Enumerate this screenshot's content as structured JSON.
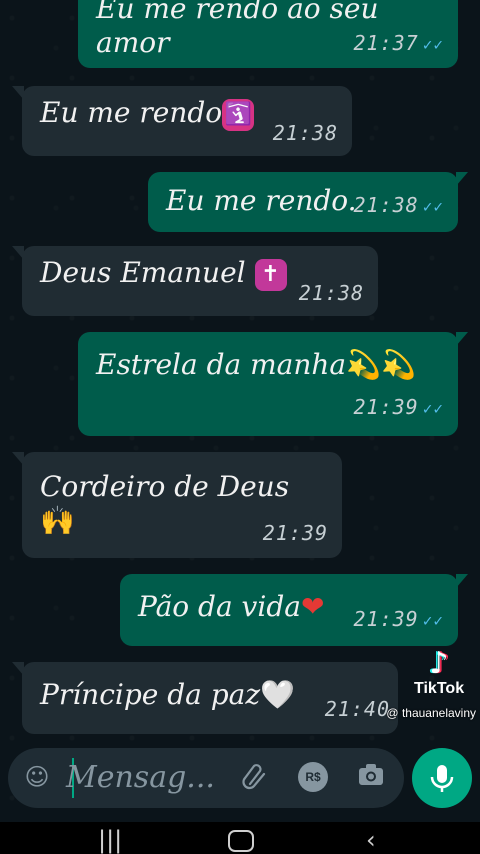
{
  "messages": [
    {
      "dir": "out",
      "text_line1": "Eu me rendo ao seu",
      "text_line2": "amor",
      "time": "21:37"
    },
    {
      "dir": "in",
      "text": "Eu me rendo",
      "emoji": "🛐",
      "time": "21:38"
    },
    {
      "dir": "out",
      "text": "Eu me rendo.",
      "time": "21:38"
    },
    {
      "dir": "in",
      "text": "Deus Emanuel",
      "emoji": "✝",
      "time": "21:38"
    },
    {
      "dir": "out",
      "text": "Estrela da manha",
      "emoji": "💫💫",
      "time": "21:39"
    },
    {
      "dir": "in",
      "text": "Cordeiro de Deus",
      "emoji": "🙌",
      "time": "21:39"
    },
    {
      "dir": "out",
      "text": "Pão da vida",
      "emoji": "❤",
      "time": "21:39"
    },
    {
      "dir": "in",
      "text": "Príncipe da paz",
      "emoji": "🤍",
      "time": "21:40"
    }
  ],
  "composer": {
    "placeholder": "Mensag...",
    "icons": [
      "emoji-icon",
      "attach-icon",
      "payment-icon",
      "camera-icon",
      "mic-icon"
    ],
    "payment_label": "R$"
  },
  "watermark": {
    "brand": "TikTok",
    "handle": "@ thauanelaviny"
  },
  "nav": {
    "icons": [
      "recent-apps-icon",
      "home-icon",
      "back-icon"
    ]
  },
  "colors": {
    "outgoing": "#005c4b",
    "incoming": "#202c33",
    "read_ticks": "#53bdeb",
    "accent": "#00a884"
  }
}
